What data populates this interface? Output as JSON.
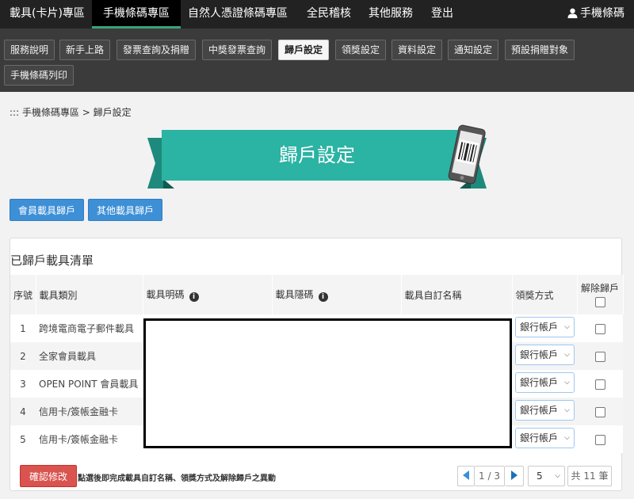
{
  "topnav": {
    "items": [
      "載具(卡片)專區",
      "手機條碼專區",
      "自然人憑證條碼專區",
      "全民稽核",
      "其他服務",
      "登出"
    ],
    "user_label": "手機條碼"
  },
  "subnav": {
    "items": [
      "服務說明",
      "新手上路",
      "發票查詢及捐贈",
      "中獎發票查詢",
      "歸戶設定",
      "領獎設定",
      "資料設定",
      "通知設定",
      "預設捐贈對象",
      "手機條碼列印"
    ]
  },
  "breadcrumb": "::: 手機條碼專區 > 歸戶設定",
  "banner_title": "歸戶設定",
  "tabs": [
    "會員載具歸戶",
    "其他載具歸戶"
  ],
  "panel": {
    "title": "已歸戶載具清單",
    "headers": {
      "seq": "序號",
      "type": "載具類別",
      "plain": "載具明碼",
      "hidden": "載具隱碼",
      "custom": "載具自訂名稱",
      "method": "領獎方式",
      "remove": "解除歸戶"
    },
    "rows": [
      {
        "seq": "1",
        "type": "跨境電商電子郵件載具",
        "method": "銀行帳戶"
      },
      {
        "seq": "2",
        "type": "全家會員載具",
        "method": "銀行帳戶"
      },
      {
        "seq": "3",
        "type": "OPEN POINT 會員載具",
        "method": "銀行帳戶"
      },
      {
        "seq": "4",
        "type": "信用卡/簽帳金融卡",
        "method": "銀行帳戶"
      },
      {
        "seq": "5",
        "type": "信用卡/簽帳金融卡",
        "method": "銀行帳戶"
      }
    ]
  },
  "footer": {
    "confirm_label": "確認修改",
    "hint": "點選後即完成載具自訂名稱、領獎方式及解除歸戶之異動",
    "page_indicator": "1 / 3",
    "page_size": "5",
    "total": "共 11 筆"
  },
  "icons": {
    "user": "user-icon",
    "info": "info-icon",
    "phone": "barcode-phone-icon"
  },
  "colors": {
    "banner_teal": "#2bb3a3",
    "active_tab_underline": "#3aa37a",
    "primary_blue": "#3d8fd6",
    "danger_red": "#d9534f"
  }
}
